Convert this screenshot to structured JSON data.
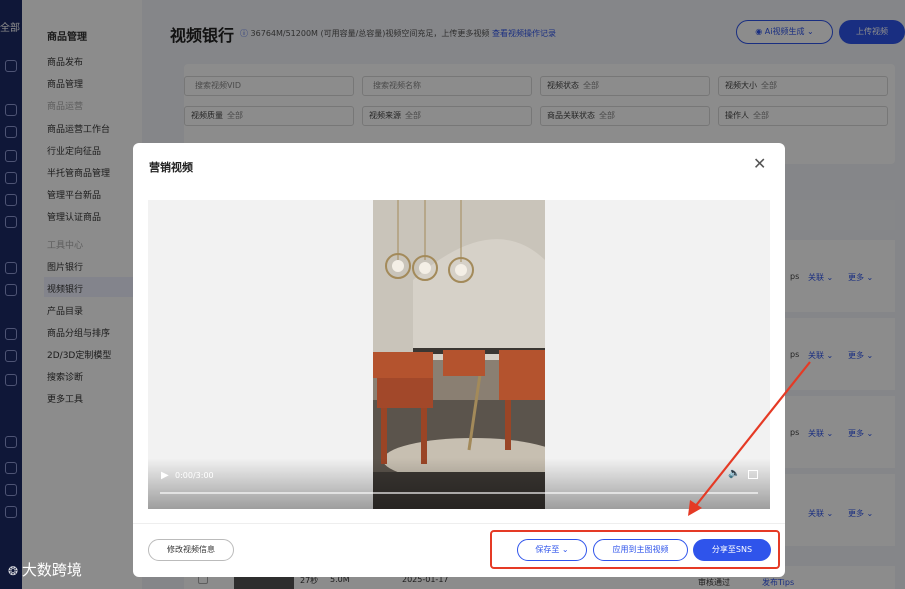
{
  "rail": {
    "top_label": "全部"
  },
  "sidebar": {
    "items": [
      {
        "label": "商品管理",
        "type": "header"
      },
      {
        "label": "商品发布",
        "type": "item"
      },
      {
        "label": "商品管理",
        "type": "item"
      },
      {
        "label": "商品运营",
        "type": "group"
      },
      {
        "label": "商品运营工作台",
        "type": "item"
      },
      {
        "label": "行业定向征品",
        "type": "item"
      },
      {
        "label": "半托管商品管理",
        "type": "item"
      },
      {
        "label": "管理平台新品",
        "type": "item"
      },
      {
        "label": "管理认证商品",
        "type": "item"
      },
      {
        "label": "工具中心",
        "type": "group"
      },
      {
        "label": "图片银行",
        "type": "item"
      },
      {
        "label": "视频银行",
        "type": "item",
        "selected": true
      },
      {
        "label": "产品目录",
        "type": "item"
      },
      {
        "label": "商品分组与排序",
        "type": "item"
      },
      {
        "label": "2D/3D定制模型",
        "type": "item"
      },
      {
        "label": "搜索诊断",
        "type": "item"
      },
      {
        "label": "更多工具",
        "type": "item"
      }
    ]
  },
  "header": {
    "title": "视频银行",
    "capacity_info": "36764M/51200M (可用容量/总容量)视频空间充足，上传更多视频",
    "ops_link": "查看视频操作记录",
    "ai_button": "Ai视频生成",
    "upload_button": "上传视频"
  },
  "filters": [
    {
      "label": "",
      "value": "搜索视频VID"
    },
    {
      "label": "",
      "value": "搜索视频名称"
    },
    {
      "label": "视频状态",
      "value": "全部"
    },
    {
      "label": "视频大小",
      "value": "全部"
    },
    {
      "label": "视频质量",
      "value": "全部"
    },
    {
      "label": "视频来源",
      "value": "全部"
    },
    {
      "label": "商品关联状态",
      "value": "全部"
    },
    {
      "label": "操作人",
      "value": "全部"
    }
  ],
  "table": {
    "row_actions": {
      "link": "关联",
      "more": "更多"
    },
    "row_partial_text": "ps",
    "last_row": {
      "count": "27秒",
      "size": "5.0M",
      "date": "2025-01-17",
      "status": "审核通过",
      "tip": "发布Tips"
    }
  },
  "modal": {
    "title": "营销视频",
    "player": {
      "time": "0:00/3:00",
      "progress": 0
    },
    "edit_button": "修改视频信息",
    "save_button": "保存至",
    "apply_button": "应用到主图视频",
    "share_button": "分享至SNS"
  },
  "watermark": "大数跨境",
  "colors": {
    "primary": "#2f54eb",
    "highlight": "#e53a25",
    "rail": "#1d2a66"
  }
}
